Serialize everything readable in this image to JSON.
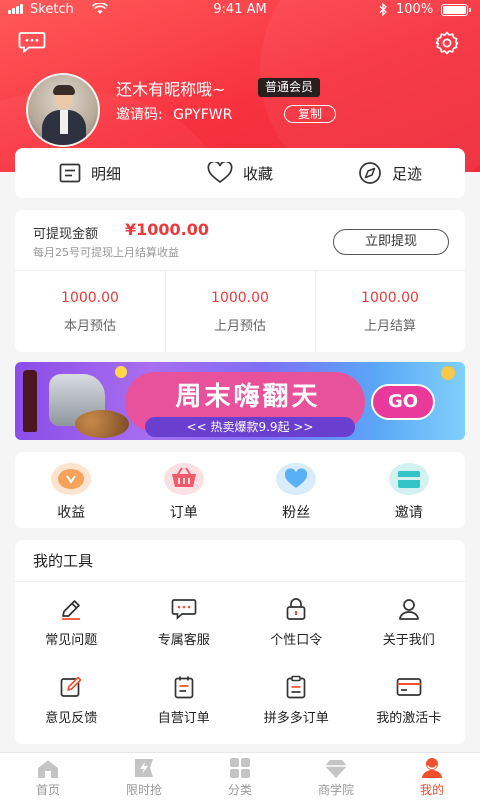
{
  "status_bar": {
    "carrier": "Sketch",
    "time": "9:41 AM",
    "battery": "100%"
  },
  "header": {
    "icons": [
      "message-icon",
      "settings-gear-icon"
    ]
  },
  "profile": {
    "nickname": "还木有昵称哦~",
    "member_badge": "普通会员",
    "invite_label": "邀请码:",
    "invite_code": "GPYFWR",
    "copy_label": "复制"
  },
  "quick_actions": [
    {
      "label": "明细",
      "icon": "detail-list-icon"
    },
    {
      "label": "收藏",
      "icon": "heart-icon"
    },
    {
      "label": "足迹",
      "icon": "compass-icon"
    }
  ],
  "wallet": {
    "withdrawable_label": "可提现金额",
    "withdrawable_amount": "¥1000.00",
    "hint": "每月25号可提现上月结算收益",
    "withdraw_button": "立即提现",
    "stats": [
      {
        "value": "1000.00",
        "label": "本月预估"
      },
      {
        "value": "1000.00",
        "label": "上月预估"
      },
      {
        "value": "1000.00",
        "label": "上月结算"
      }
    ]
  },
  "banner": {
    "title": "周末嗨翻天",
    "subtitle": "<< 热卖爆款9.9起 >>",
    "go_label": "GO"
  },
  "shortcuts": [
    {
      "label": "收益",
      "icon": "earnings-icon",
      "color": "#f5a25a"
    },
    {
      "label": "订单",
      "icon": "basket-icon",
      "color": "#f05a6a"
    },
    {
      "label": "粉丝",
      "icon": "heart-icon",
      "color": "#5ab0f5"
    },
    {
      "label": "邀请",
      "icon": "invite-box-icon",
      "color": "#34c3c6"
    }
  ],
  "tools": {
    "title": "我的工具",
    "items": [
      {
        "label": "常见问题",
        "icon": "pen-icon"
      },
      {
        "label": "专属客服",
        "icon": "chat-icon"
      },
      {
        "label": "个性口令",
        "icon": "lock-icon"
      },
      {
        "label": "关于我们",
        "icon": "user-icon"
      },
      {
        "label": "意见反馈",
        "icon": "edit-icon"
      },
      {
        "label": "自营订单",
        "icon": "order-list-icon"
      },
      {
        "label": "拼多多订单",
        "icon": "clipboard-icon"
      },
      {
        "label": "我的激活卡",
        "icon": "card-icon"
      }
    ]
  },
  "tabbar": {
    "items": [
      {
        "label": "首页",
        "icon": "home-icon"
      },
      {
        "label": "限时抢",
        "icon": "flash-tag-icon"
      },
      {
        "label": "分类",
        "icon": "grid-icon"
      },
      {
        "label": "商学院",
        "icon": "diamond-icon"
      },
      {
        "label": "我的",
        "icon": "profile-icon"
      }
    ],
    "active": "我的"
  },
  "colors": {
    "brand_red": "#f7323f",
    "price_red": "#e93b3b",
    "active_tab": "#f0502e"
  }
}
